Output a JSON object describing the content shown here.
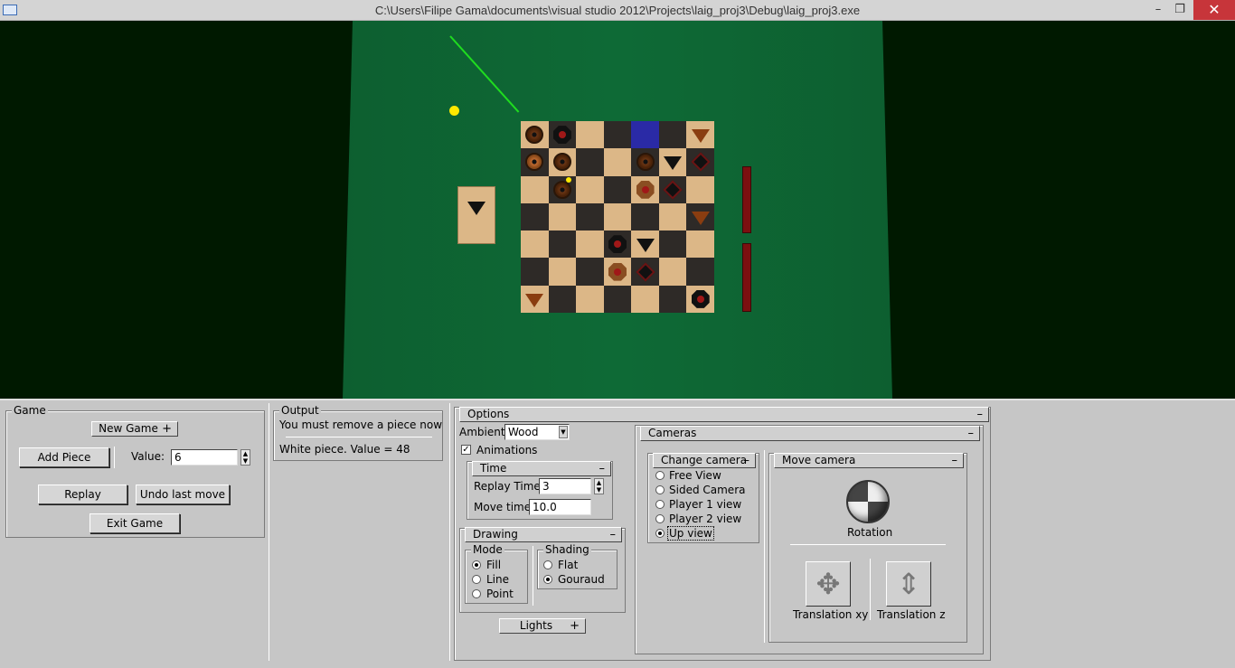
{
  "window": {
    "title": "C:\\Users\\Filipe Gama\\documents\\visual studio 2012\\Projects\\laig_proj3\\Debug\\laig_proj3.exe",
    "minimize": "–",
    "restore": "❐",
    "close": "✕"
  },
  "game_panel": {
    "title": "Game",
    "new_game": "New Game",
    "new_game_sym": "+",
    "add_piece": "Add Piece",
    "value_label": "Value:",
    "value": "6",
    "replay": "Replay",
    "undo": "Undo last move",
    "exit": "Exit Game"
  },
  "output_panel": {
    "title": "Output",
    "message": "You must remove a piece now",
    "piece_info": "White piece. Value = 48"
  },
  "options_panel": {
    "title": "Options",
    "collapse": "–",
    "ambient_label": "Ambient",
    "ambient_value": "Wood",
    "animations_label": "Animations",
    "animations_checked": true,
    "time": {
      "title": "Time",
      "collapse": "–",
      "replay_label": "Replay Time",
      "replay_value": "3",
      "move_label": "Move time",
      "move_value": "10.0"
    },
    "drawing": {
      "title": "Drawing",
      "collapse": "–",
      "mode_title": "Mode",
      "modes": [
        "Fill",
        "Line",
        "Point"
      ],
      "mode_selected": "Fill",
      "shading_title": "Shading",
      "shadings": [
        "Flat",
        "Gouraud"
      ],
      "shading_selected": "Gouraud"
    },
    "lights": "Lights",
    "lights_sym": "+"
  },
  "cameras_panel": {
    "title": "Cameras",
    "collapse": "–",
    "change_camera": "Change camera",
    "change_collapse": "–",
    "options": [
      "Free View",
      "Sided Camera",
      "Player 1 view",
      "Player 2 view",
      "Up view"
    ],
    "selected": "Up view",
    "move_camera": "Move camera",
    "move_collapse": "–",
    "rotation": "Rotation",
    "translation_xy": "Translation xy",
    "translation_z": "Translation z"
  },
  "board": {
    "rows": [
      [
        "L:pa",
        "D:ob",
        "L:",
        "D:",
        "B:",
        "D:",
        "L:tw"
      ],
      [
        "D:pb",
        "L:pa",
        "D:",
        "L:",
        "D:pa",
        "L:t",
        "D:dk"
      ],
      [
        "L:",
        "D:pa",
        "L:",
        "D:",
        "L:ow",
        "D:dk",
        "L:"
      ],
      [
        "D:",
        "L:",
        "D:",
        "L:",
        "D:",
        "L:",
        "D:tw"
      ],
      [
        "L:",
        "D:",
        "L:",
        "D:ob",
        "L:t",
        "D:",
        "L:"
      ],
      [
        "D:",
        "L:",
        "D:",
        "L:ow",
        "D:dk",
        "L:",
        "D:"
      ],
      [
        "L:tw",
        "D:",
        "L:",
        "D:",
        "L:",
        "D:",
        "L:ob"
      ]
    ]
  },
  "colors": {
    "table_green": "#0e6a36",
    "background": "#001900",
    "highlight_square": "#2a2aa6",
    "laser": "#1fdc1f",
    "light": "#ffe800"
  }
}
